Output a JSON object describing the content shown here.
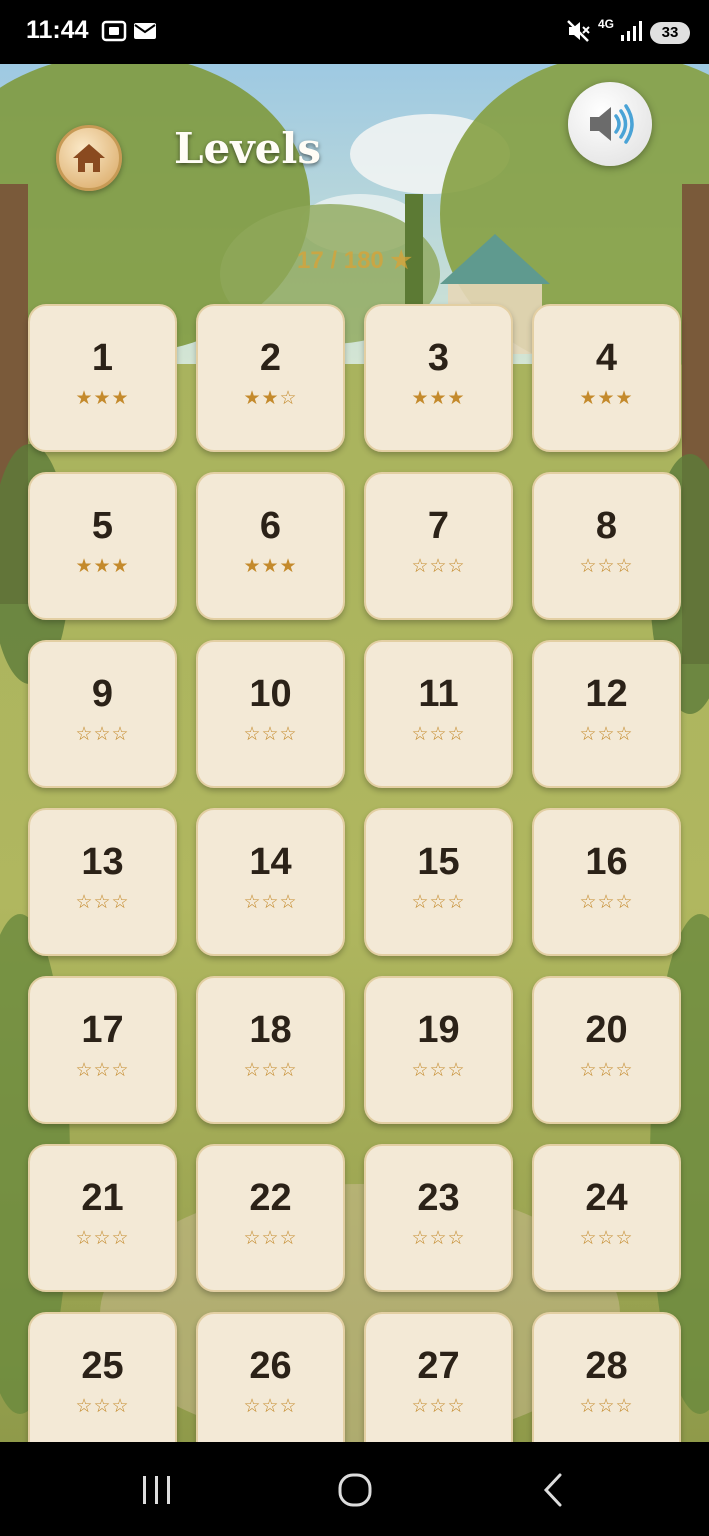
{
  "status_bar": {
    "time": "11:44",
    "network": "4G",
    "battery": "33",
    "icons": [
      "screenshot-icon",
      "mail-icon",
      "mute-icon",
      "signal-icon"
    ]
  },
  "header": {
    "title": "Levels",
    "home_icon": "home-icon",
    "sound_icon": "speaker-icon",
    "star_count": "17 / 180 ★"
  },
  "levels": [
    {
      "number": "1",
      "stars": "★★★"
    },
    {
      "number": "2",
      "stars": "★★☆"
    },
    {
      "number": "3",
      "stars": "★★★"
    },
    {
      "number": "4",
      "stars": "★★★"
    },
    {
      "number": "5",
      "stars": "★★★"
    },
    {
      "number": "6",
      "stars": "★★★"
    },
    {
      "number": "7",
      "stars": "☆☆☆"
    },
    {
      "number": "8",
      "stars": "☆☆☆"
    },
    {
      "number": "9",
      "stars": "☆☆☆"
    },
    {
      "number": "10",
      "stars": "☆☆☆"
    },
    {
      "number": "11",
      "stars": "☆☆☆"
    },
    {
      "number": "12",
      "stars": "☆☆☆"
    },
    {
      "number": "13",
      "stars": "☆☆☆"
    },
    {
      "number": "14",
      "stars": "☆☆☆"
    },
    {
      "number": "15",
      "stars": "☆☆☆"
    },
    {
      "number": "16",
      "stars": "☆☆☆"
    },
    {
      "number": "17",
      "stars": "☆☆☆"
    },
    {
      "number": "18",
      "stars": "☆☆☆"
    },
    {
      "number": "19",
      "stars": "☆☆☆"
    },
    {
      "number": "20",
      "stars": "☆☆☆"
    },
    {
      "number": "21",
      "stars": "☆☆☆"
    },
    {
      "number": "22",
      "stars": "☆☆☆"
    },
    {
      "number": "23",
      "stars": "☆☆☆"
    },
    {
      "number": "24",
      "stars": "☆☆☆"
    },
    {
      "number": "25",
      "stars": "☆☆☆"
    },
    {
      "number": "26",
      "stars": "☆☆☆"
    },
    {
      "number": "27",
      "stars": "☆☆☆"
    },
    {
      "number": "28",
      "stars": "☆☆☆"
    }
  ],
  "nav_bar": {
    "icons": [
      "recents-icon",
      "home-circle-icon",
      "back-icon"
    ]
  },
  "colors": {
    "tile_bg": "#f3e9d6",
    "star": "#c48a2c",
    "star_count": "#d9a336",
    "title": "#fffdf6"
  }
}
